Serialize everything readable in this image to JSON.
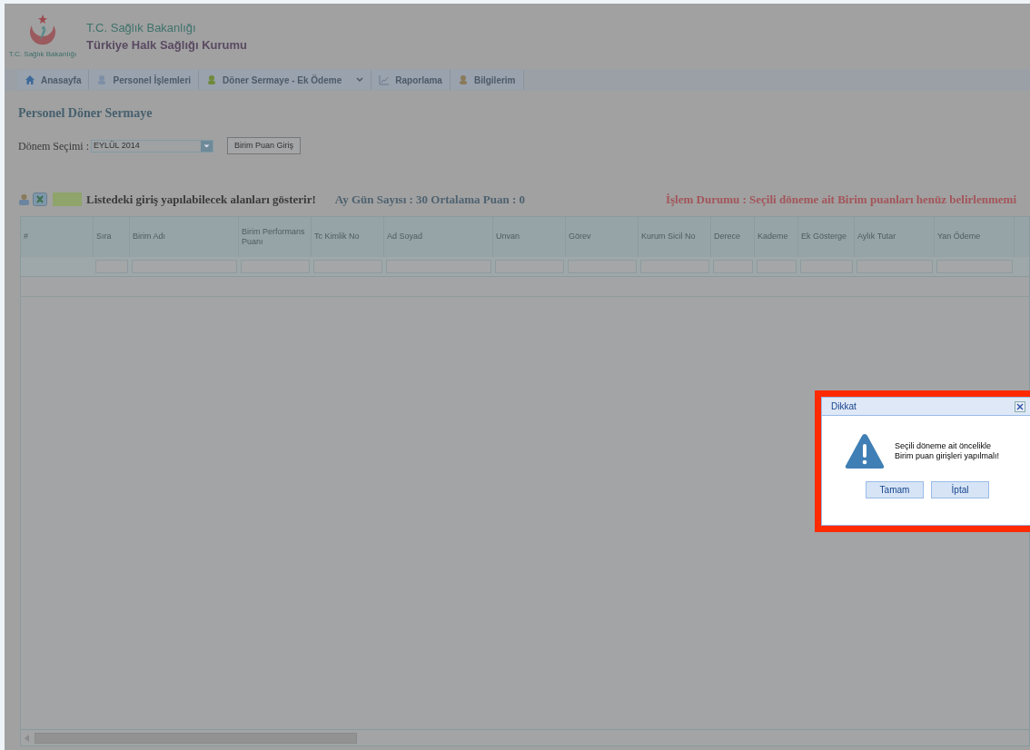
{
  "header": {
    "logo_caption": "T.C. Sağlık Bakanlığı",
    "ministry": "T.C. Sağlık Bakanlığı",
    "institution": "Türkiye Halk Sağlığı Kurumu"
  },
  "menu": [
    {
      "label": "Anasayfa",
      "dropdown": false
    },
    {
      "label": "Personel İşlemleri",
      "dropdown": false
    },
    {
      "label": "Döner Sermaye - Ek Ödeme",
      "dropdown": true
    },
    {
      "label": "Raporlama",
      "dropdown": false
    },
    {
      "label": "Bilgilerim",
      "dropdown": false
    }
  ],
  "page_title": "Personel Döner Sermaye",
  "period": {
    "label": "Dönem Seçimi :",
    "value": "EYLÜL 2014"
  },
  "unit_score_button": "Birim Puan Giriş",
  "legend": "Listedeki giriş yapılabilecek alanları gösterir!",
  "summary": "Ay Gün Sayısı : 30 Ortalama Puan : 0",
  "status": "İşlem Durumu : Seçili döneme ait Birim puanları henüz belirlenmemi",
  "table": {
    "columns": [
      "#",
      "Sıra",
      "Birim Adı",
      "Birim Performans Puanı",
      "Tc Kimlik No",
      "Ad Soyad",
      "Unvan",
      "Görev",
      "Kurum Sicil No",
      "Derece",
      "Kademe",
      "Ek Gösterge",
      "Aylık Tutar",
      "Yan Ödeme"
    ]
  },
  "dialog": {
    "title": "Dikkat",
    "message_lines": [
      "Seçili döneme ait öncelikle",
      "Birim puan girişleri yapılmalı!"
    ],
    "buttons": [
      "Tamam",
      "İptal"
    ]
  }
}
